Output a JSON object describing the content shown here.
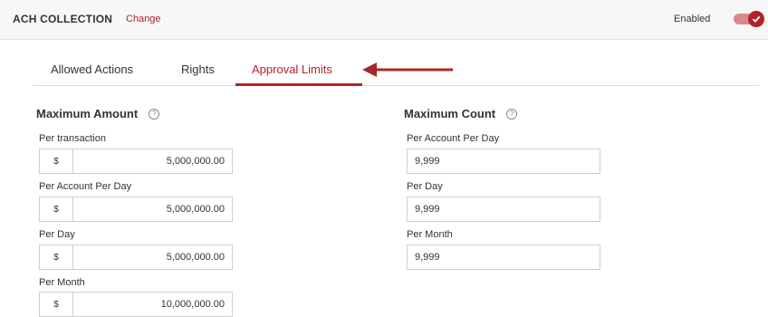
{
  "header": {
    "title": "ACH COLLECTION",
    "change_label": "Change",
    "enabled_label": "Enabled",
    "enabled": true,
    "accent_color": "#b0232a"
  },
  "tabs": [
    {
      "label": "Allowed Actions",
      "active": false
    },
    {
      "label": "Rights",
      "active": false
    },
    {
      "label": "Approval Limits",
      "active": true
    }
  ],
  "max_amount": {
    "title": "Maximum Amount",
    "help_icon": "?",
    "currency_symbol": "$",
    "fields": [
      {
        "label": "Per transaction",
        "value": "5,000,000.00"
      },
      {
        "label": "Per Account Per Day",
        "value": "5,000,000.00"
      },
      {
        "label": "Per Day",
        "value": "5,000,000.00"
      },
      {
        "label": "Per Month",
        "value": "10,000,000.00"
      }
    ]
  },
  "max_count": {
    "title": "Maximum Count",
    "help_icon": "?",
    "fields": [
      {
        "label": "Per Account Per Day",
        "value": "9,999"
      },
      {
        "label": "Per Day",
        "value": "9,999"
      },
      {
        "label": "Per Month",
        "value": "9,999"
      }
    ]
  }
}
